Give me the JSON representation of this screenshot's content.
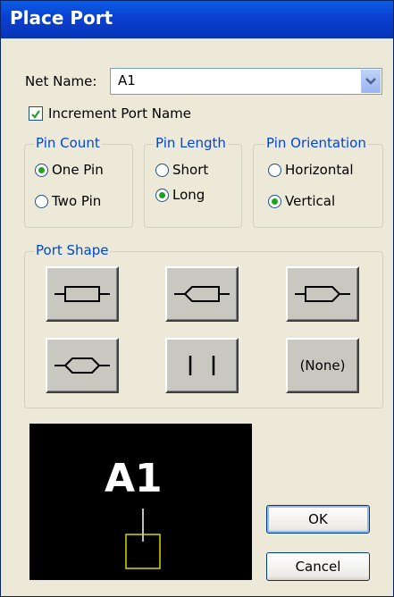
{
  "window": {
    "title": "Place Port"
  },
  "net_name": {
    "label": "Net Name:",
    "value": "A1"
  },
  "increment": {
    "label": "Increment Port Name",
    "checked": true
  },
  "pin_count": {
    "legend": "Pin Count",
    "options": [
      "One Pin",
      "Two Pin"
    ],
    "selected": "One Pin"
  },
  "pin_length": {
    "legend": "Pin Length",
    "options": [
      "Short",
      "Long"
    ],
    "selected": "Long"
  },
  "pin_orientation": {
    "legend": "Pin Orientation",
    "options": [
      "Horizontal",
      "Vertical"
    ],
    "selected": "Vertical"
  },
  "port_shape": {
    "legend": "Port Shape",
    "none_label": "(None)"
  },
  "preview": {
    "text": "A1",
    "line_color": "#ffffff",
    "box_color": "#d8d800"
  },
  "buttons": {
    "ok": "OK",
    "cancel": "Cancel"
  },
  "icons": {
    "dropdown": "chevron-down-icon",
    "checkbox": "checkmark-icon"
  }
}
